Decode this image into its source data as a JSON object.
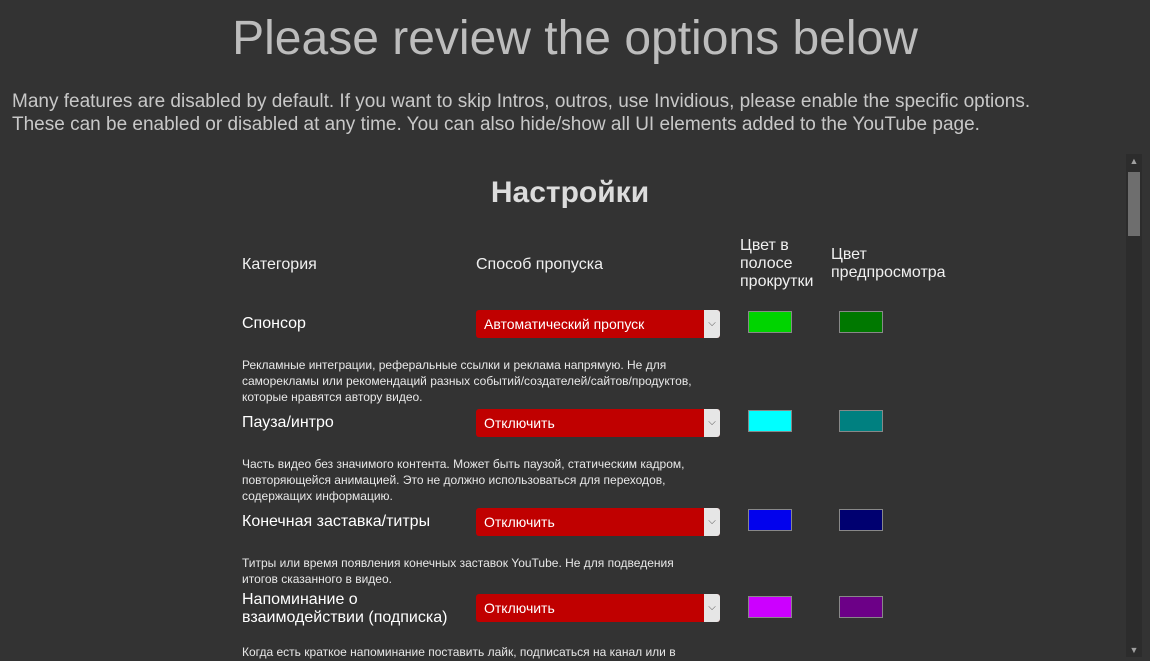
{
  "page": {
    "title": "Please review the options below",
    "intro_line1": "Many features are disabled by default. If you want to skip Intros, outros, use Invidious, please enable the specific options.",
    "intro_line2": "These can be enabled or disabled at any time. You can also hide/show all UI elements added to the YouTube page."
  },
  "settings": {
    "title": "Настройки",
    "headers": {
      "category": "Категория",
      "skip_method": "Способ пропуска",
      "bar_color_l1": "Цвет в",
      "bar_color_l2": "полосе",
      "bar_color_l3": "прокрутки",
      "preview_color_l1": "Цвет",
      "preview_color_l2": "предпросмотра"
    },
    "categories": [
      {
        "name": "Спонсор",
        "option": "Автоматический пропуск",
        "bar_color": "#00d400",
        "preview_color": "#007800",
        "desc": [
          "Рекламные интеграции, реферальные ссылки и реклама напрямую. Не для",
          "саморекламы или рекомендаций разных событий/создателей/сайтов/продуктов,",
          "которые нравятся автору видео."
        ]
      },
      {
        "name": "Пауза/интро",
        "option": "Отключить",
        "bar_color": "#00ffff",
        "preview_color": "#008080",
        "desc": [
          "Часть видео без значимого контента. Может быть паузой, статическим кадром,",
          "повторяющейся анимацией. Это не должно использоваться для переходов,",
          "содержащих информацию."
        ]
      },
      {
        "name": "Конечная заставка/титры",
        "option": "Отключить",
        "bar_color": "#0202ed",
        "preview_color": "#000070",
        "desc": [
          "Титры или время появления конечных заставок YouTube. Не для подведения",
          "итогов сказанного в видео."
        ]
      },
      {
        "name_l1": "Напоминание о",
        "name_l2": "взаимодействии (подписка)",
        "option": "Отключить",
        "bar_color": "#cc00ff",
        "preview_color": "#6c0087",
        "desc": [
          "Когда есть краткое напоминание поставить лайк, подписаться на канал или в"
        ]
      }
    ]
  },
  "icons": {
    "dropdown": "chevron-down-icon",
    "scroll_up": "triangle-up-icon",
    "scroll_down": "triangle-down-icon"
  }
}
